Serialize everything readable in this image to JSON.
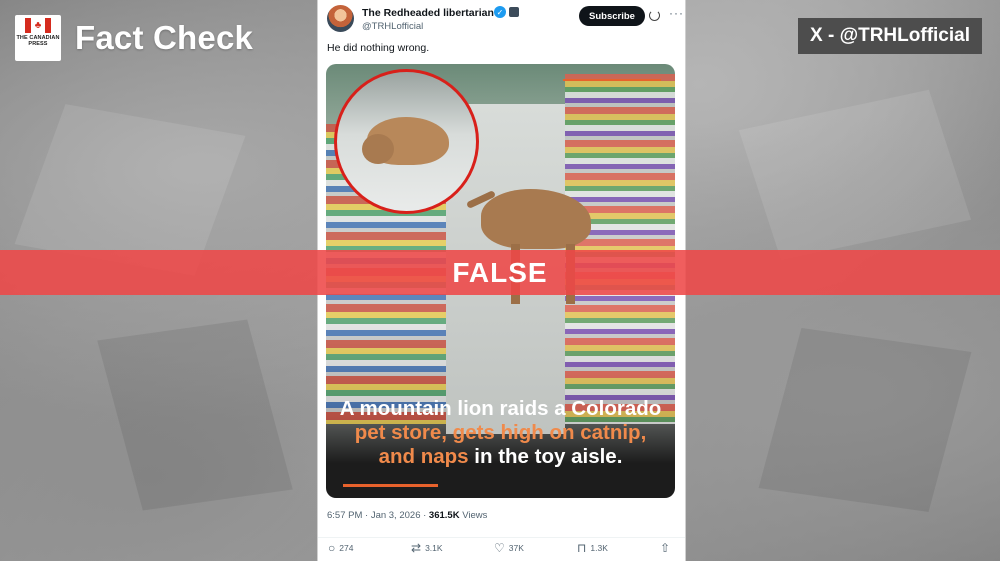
{
  "brand": {
    "logo_text": "THE CANADIAN PRESS",
    "title": "Fact Check"
  },
  "source_label": "X - @TRHLofficial",
  "verdict": "FALSE",
  "tweet": {
    "author_name": "The Redheaded libertarian",
    "author_handle": "@TRHLofficial",
    "subscribe_label": "Subscribe",
    "text": "He did nothing wrong.",
    "media": {
      "caption_parts": [
        {
          "text": "A mountain lion raids a Colorado ",
          "highlight": false
        },
        {
          "text": "pet store, gets high on catnip, and naps",
          "highlight": true
        },
        {
          "text": " in the toy aisle.",
          "highlight": false
        }
      ],
      "highlight_color": "#f08a4b",
      "inset_border_color": "#d8201a"
    },
    "timestamp": "6:57 PM · Jan 3, 2026 · ",
    "views_count": "361.5K",
    "views_label": " Views",
    "actions": {
      "replies": "274",
      "reposts": "3.1K",
      "likes": "37K",
      "bookmarks": "1.3K"
    }
  },
  "colors": {
    "verdict_band": "#ee4848",
    "verified_blue": "#1d9bf0"
  }
}
